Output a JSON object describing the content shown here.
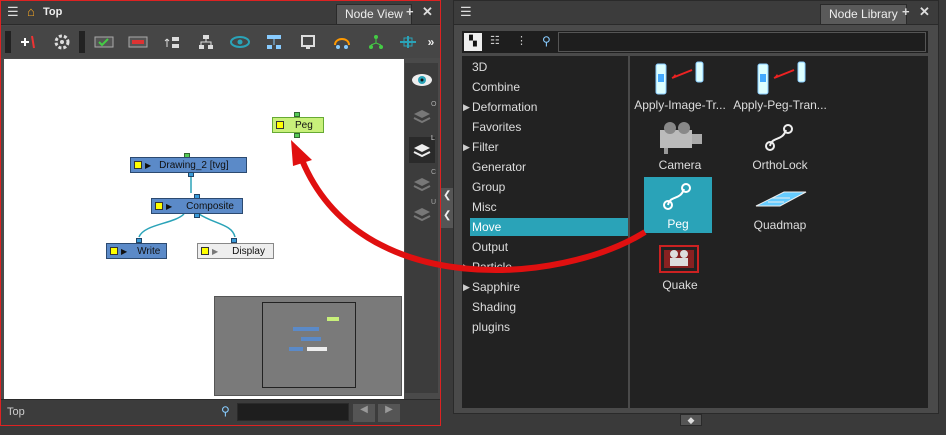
{
  "node_view": {
    "title": "Top",
    "tab_label": "Node View",
    "footer_label": "Top",
    "search_placeholder": "",
    "nodes": {
      "peg": "Peg",
      "drawing": "Drawing_2 [tvg]",
      "composite": "Composite",
      "write": "Write",
      "display": "Display"
    },
    "side_letters": [
      "O",
      "L",
      "C",
      "U"
    ]
  },
  "node_library": {
    "tab_label": "Node Library",
    "search_value": "",
    "categories": [
      "3D",
      "Combine",
      "Deformation",
      "Favorites",
      "Filter",
      "Generator",
      "Group",
      "Misc",
      "Move",
      "Output",
      "Particle",
      "Sapphire",
      "Shading",
      "plugins"
    ],
    "selected_category": "Move",
    "items": [
      "Apply-Image-Tr...",
      "Apply-Peg-Tran...",
      "Camera",
      "OrthoLock",
      "Peg",
      "Quadmap",
      "Quake"
    ],
    "selected_item": "Peg"
  },
  "colors": {
    "selection": "#2aa3b8",
    "panel_border_active": "#d22222",
    "arrow": "#e01010",
    "node_blue": "#5b8ac8",
    "peg_green": "#c8f07a"
  }
}
